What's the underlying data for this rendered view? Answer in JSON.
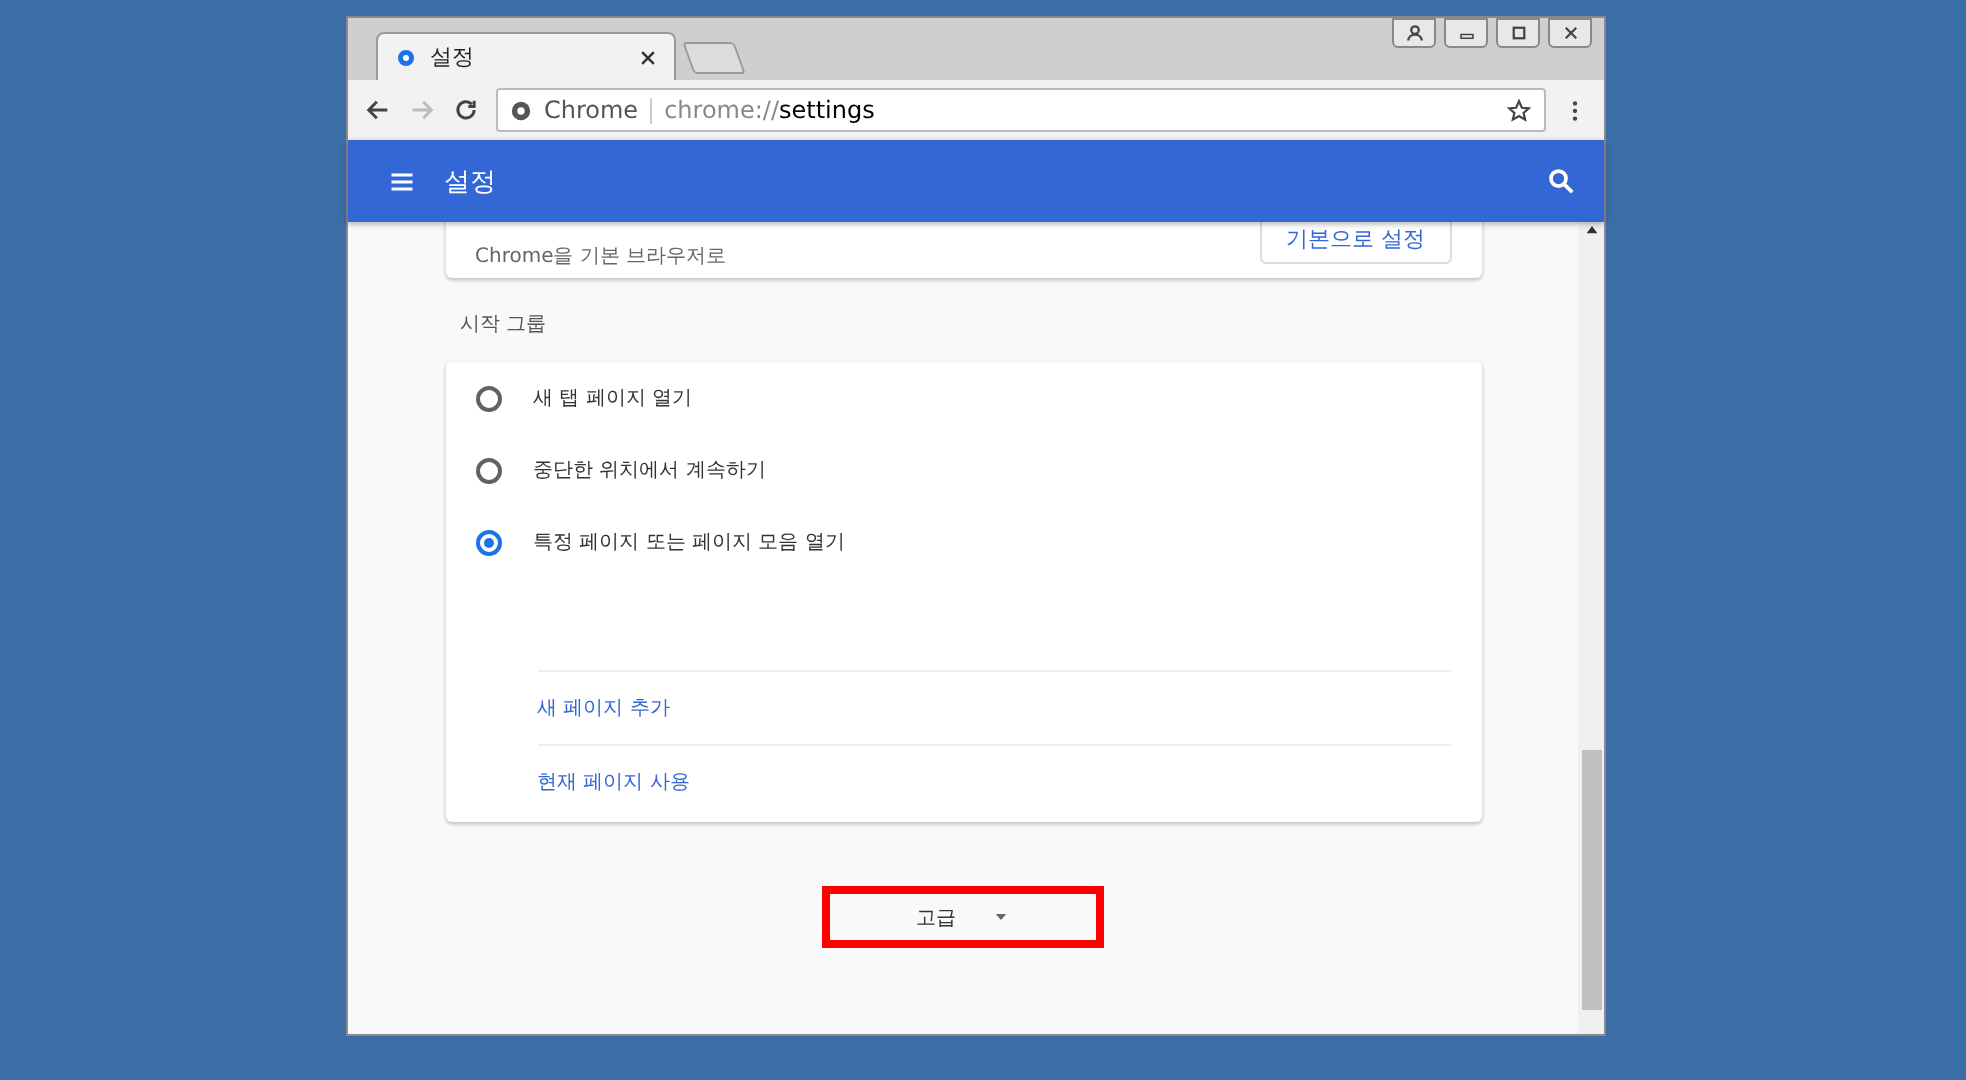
{
  "tab": {
    "title": "설정"
  },
  "address": {
    "site": "Chrome",
    "url_prefix": "chrome://",
    "url_path": "settings"
  },
  "header": {
    "title": "설정"
  },
  "default_browser": {
    "text": "Chrome을 기본 브라우저로",
    "button": "기본으로 설정"
  },
  "startup": {
    "title": "시작 그룹",
    "options": [
      {
        "label": "새 탭 페이지 열기",
        "selected": false
      },
      {
        "label": "중단한 위치에서 계속하기",
        "selected": false
      },
      {
        "label": "특정 페이지 또는 페이지 모음 열기",
        "selected": true
      }
    ],
    "links": [
      "새 페이지 추가",
      "현재 페이지 사용"
    ]
  },
  "advanced": {
    "label": "고급",
    "highlighted": true
  }
}
